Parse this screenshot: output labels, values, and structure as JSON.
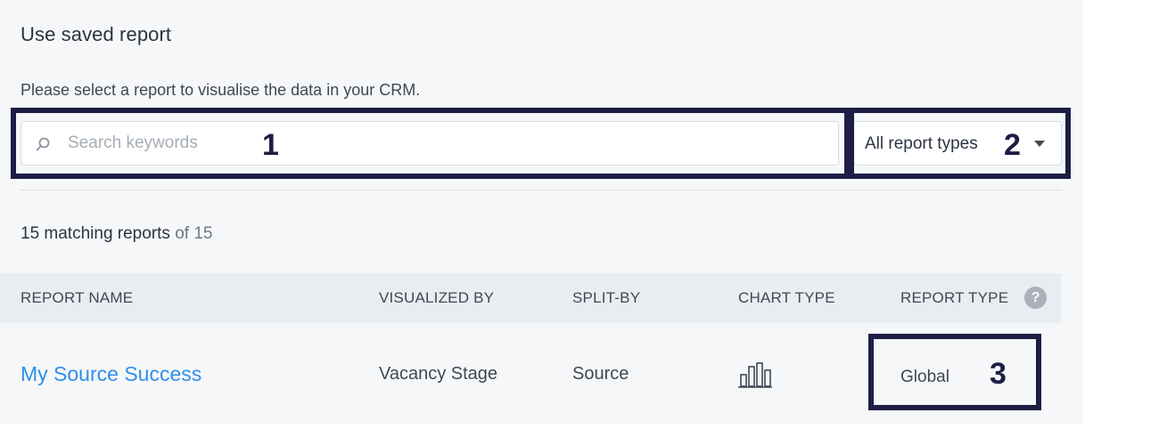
{
  "header": {
    "title": "Use saved report",
    "description": "Please select a report to visualise the data in your CRM."
  },
  "search": {
    "placeholder": "Search keywords",
    "value": ""
  },
  "filter": {
    "selected": "All report types"
  },
  "results": {
    "count_label": "15 matching reports",
    "of_label": "of 15"
  },
  "table": {
    "columns": [
      "REPORT NAME",
      "VISUALIZED BY",
      "SPLIT-BY",
      "CHART TYPE",
      "REPORT TYPE"
    ],
    "help_glyph": "?",
    "rows": [
      {
        "report_name": "My Source Success",
        "visualized_by": "Vacancy Stage",
        "split_by": "Source",
        "chart_type_icon": "bar-chart-icon",
        "report_type": "Global"
      }
    ]
  },
  "annotations": {
    "labels": [
      "1",
      "2",
      "3"
    ],
    "color": "#1e1d45"
  },
  "colors": {
    "link": "#2f8fe8",
    "panel": "#f6f7f9",
    "header_row": "#e9edf1"
  }
}
